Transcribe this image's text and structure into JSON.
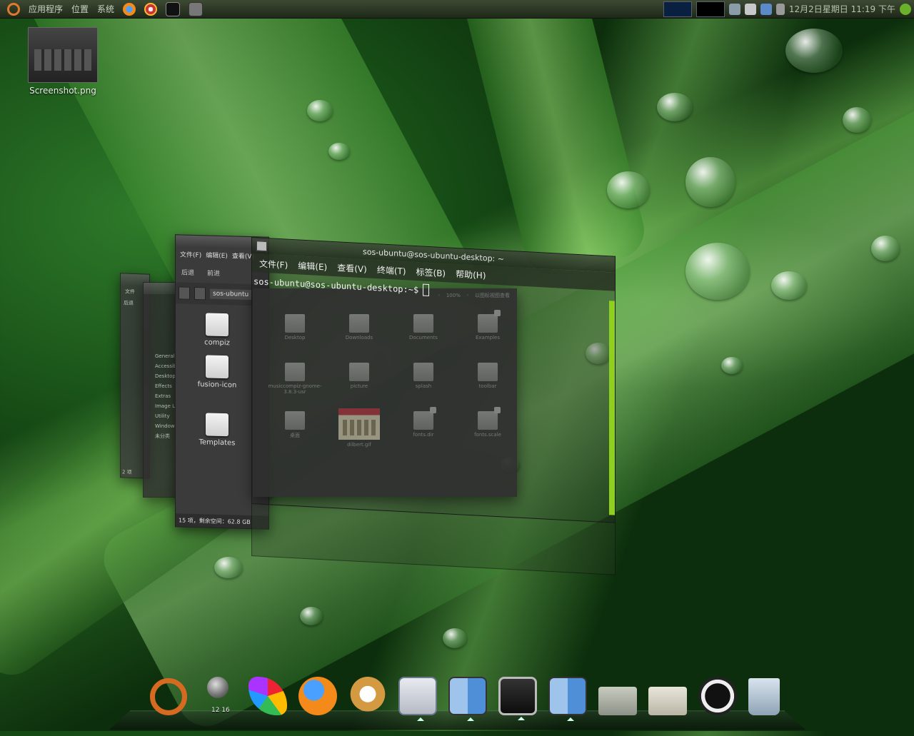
{
  "top_panel": {
    "menus": [
      "应用程序",
      "位置",
      "系统"
    ],
    "clock": "12月2日星期日 11:19 下午"
  },
  "desktop": {
    "icons": [
      {
        "label": "Screenshot.png"
      }
    ]
  },
  "windows": {
    "far_left": {
      "menu": [
        "文件"
      ],
      "items": [
        "后退"
      ],
      "status": "2 项"
    },
    "prefs": {
      "list": [
        "General",
        "Accessibi",
        "Desktop",
        "Effects",
        "Extras",
        "Image Lo",
        "Utility",
        "Window M",
        "未分类"
      ]
    },
    "nautilus_small": {
      "menu": [
        "文件(F)",
        "编辑(E)",
        "查看(V)"
      ],
      "nav": [
        "后退",
        "前进"
      ],
      "location": "sos-ubuntu",
      "files": [
        "compiz",
        "fusion-icon",
        "Templates"
      ],
      "status": "15 项，剩余空间：62.8 GB"
    },
    "nautilus_big": {
      "zoom": "100%",
      "view_mode": "以图标视图查看",
      "files": [
        {
          "name": "Desktop",
          "kind": "folder"
        },
        {
          "name": "Downloads",
          "kind": "folder"
        },
        {
          "name": "Documents",
          "kind": "folder"
        },
        {
          "name": "Examples",
          "kind": "folder-lock"
        },
        {
          "name": "musiccompiz-gnome-3.8.3-usr",
          "kind": "folder"
        },
        {
          "name": "picture",
          "kind": "folder"
        },
        {
          "name": "splash",
          "kind": "folder"
        },
        {
          "name": "toolbar",
          "kind": "folder"
        },
        {
          "name": "桌面",
          "kind": "folder"
        },
        {
          "name": "dilbert.gif",
          "kind": "image"
        },
        {
          "name": "fonts.dir",
          "kind": "file-lock"
        },
        {
          "name": "fonts.scale",
          "kind": "file-lock"
        }
      ]
    },
    "terminal": {
      "title": "sos-ubuntu@sos-ubuntu-desktop: ~",
      "menu": [
        "文件(F)",
        "编辑(E)",
        "查看(V)",
        "终端(T)",
        "标签(B)",
        "帮助(H)"
      ],
      "prompt": "sos-ubuntu@sos-ubuntu-desktop:~$"
    }
  },
  "dock": {
    "items": [
      {
        "name": "ubuntu"
      },
      {
        "name": "clock"
      },
      {
        "name": "paint"
      },
      {
        "name": "firefox"
      },
      {
        "name": "gnu"
      },
      {
        "name": "tools"
      },
      {
        "name": "finder"
      },
      {
        "name": "terminal"
      },
      {
        "name": "finder-2"
      },
      {
        "name": "downloads"
      },
      {
        "name": "folder"
      },
      {
        "name": "power"
      },
      {
        "name": "trash"
      }
    ],
    "clock_label": "12 16"
  },
  "colors": {
    "accent": "#8fcf1e",
    "ubuntu_orange": "#d66a21"
  }
}
